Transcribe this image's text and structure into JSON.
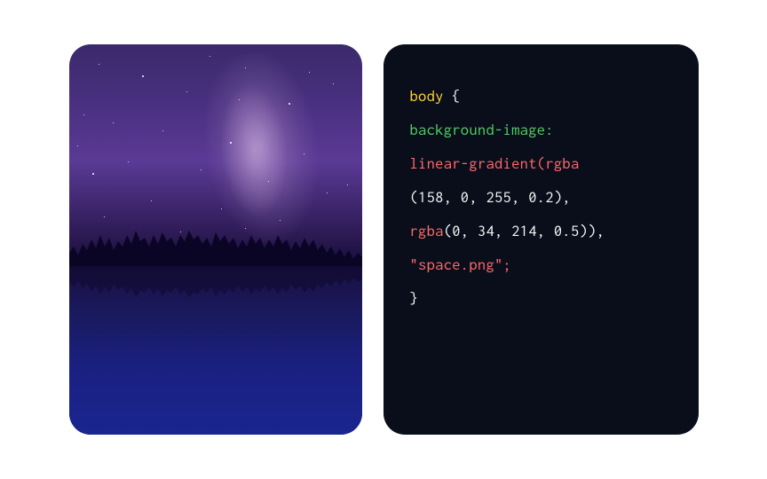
{
  "code": {
    "line1": {
      "selector": "body",
      "brace": " {"
    },
    "line2": {
      "property": "background-image:"
    },
    "line3": {
      "function": "linear-gradient",
      "paren": "(",
      "rgba": "rgba"
    },
    "line4": {
      "value": "(158, 0, 255, 0.2),"
    },
    "line5": {
      "rgba": "rgba",
      "value": "(0, 34, 214, 0.5)),"
    },
    "line6": {
      "string": "\"space.png\";"
    },
    "line7": {
      "brace": "}"
    }
  }
}
